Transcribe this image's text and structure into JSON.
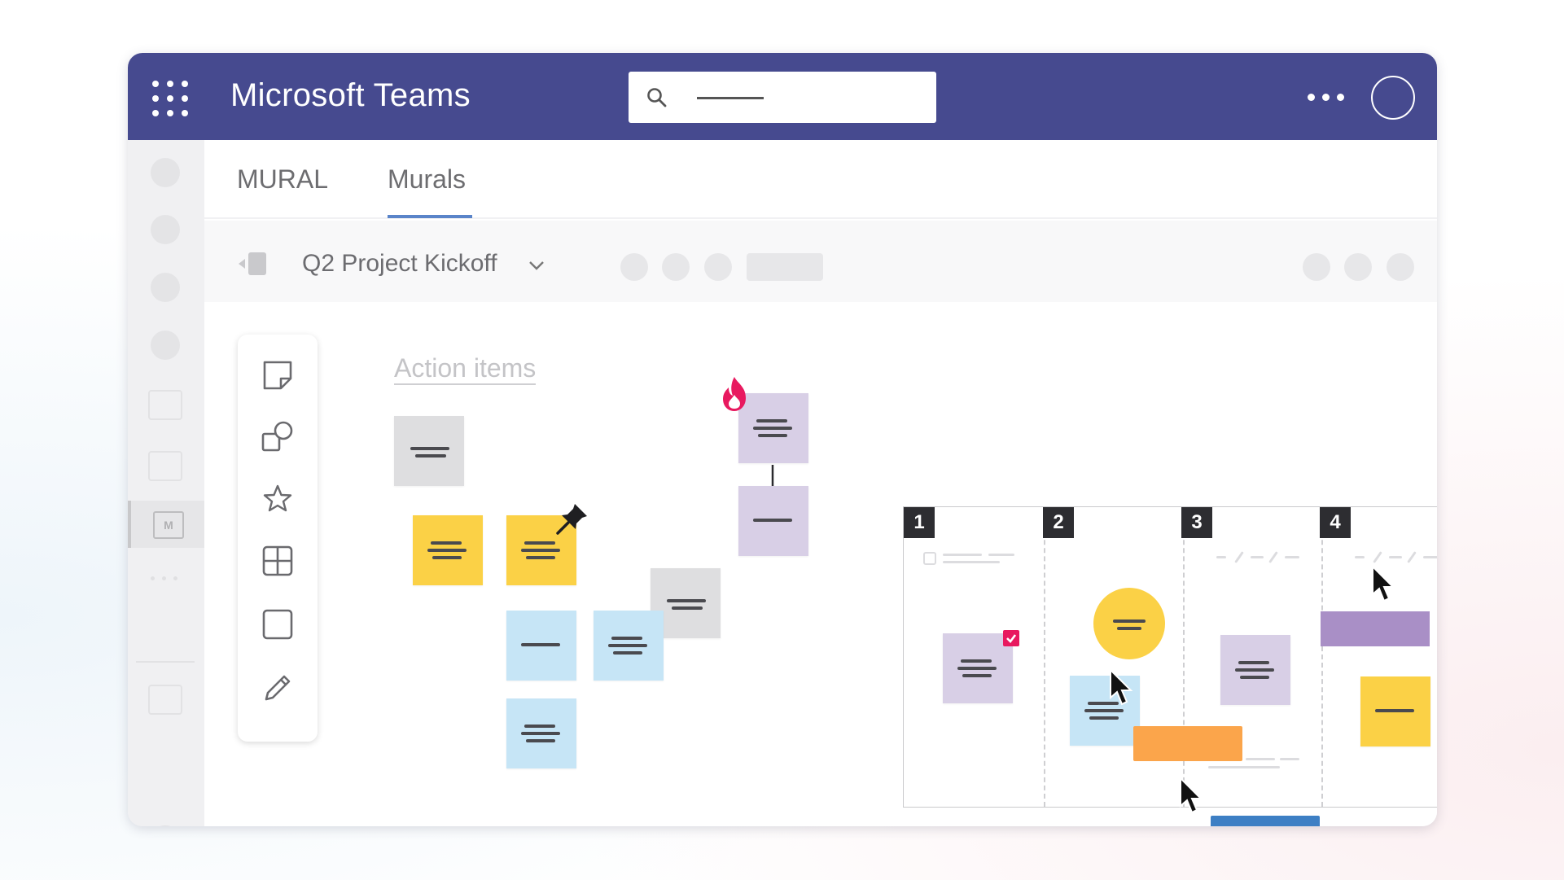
{
  "app": {
    "title": "Microsoft Teams",
    "topbar_color": "#464a8f"
  },
  "tabs": [
    {
      "label": "MURAL",
      "active": false
    },
    {
      "label": "Murals",
      "active": true
    }
  ],
  "mural": {
    "title": "Q2 Project Kickoff"
  },
  "canvas": {
    "heading": "Action items",
    "columns": [
      "1",
      "2",
      "3",
      "4"
    ]
  },
  "icons": {
    "toolbar": [
      "sticky-note-icon",
      "shapes-icon",
      "star-icon",
      "grid-icon",
      "frame-icon",
      "pen-icon"
    ],
    "topbar": [
      "app-grid-icon",
      "search-icon",
      "more-icon",
      "avatar"
    ]
  },
  "colors": {
    "yellow": "#fbd146",
    "lavender": "#d8cfe6",
    "blue": "#c6e5f6",
    "gray": "#dedee0",
    "orange": "#fba54b",
    "purple": "#a98fc6",
    "dark_blue": "#3d7fc4",
    "accent_pink": "#e8195f"
  }
}
